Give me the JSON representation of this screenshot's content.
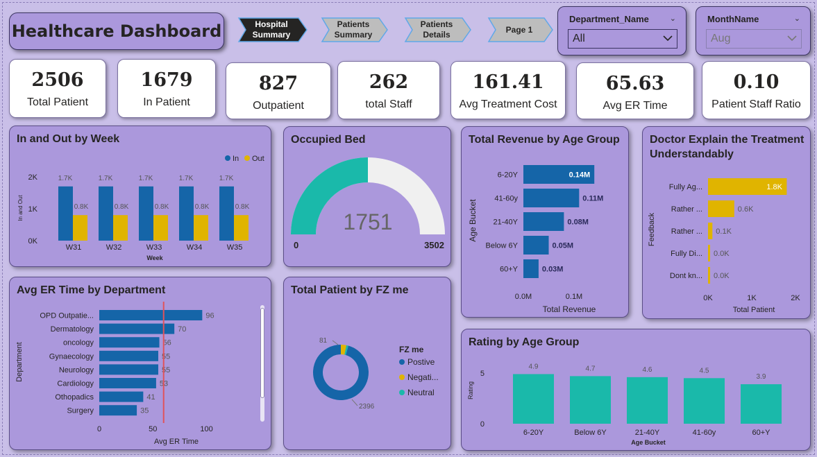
{
  "header": {
    "title": "Healthcare Dashboard"
  },
  "nav": [
    {
      "label": "Hospital\nSummary",
      "active": true
    },
    {
      "label": "Patients\nSummary",
      "active": false
    },
    {
      "label": "Patients\nDetails",
      "active": false
    },
    {
      "label": "Page 1",
      "active": false
    }
  ],
  "slicers": {
    "department": {
      "label": "Department_Name",
      "value": "All"
    },
    "month": {
      "label": "MonthName",
      "value": "Aug"
    }
  },
  "kpis": [
    {
      "value": "2506",
      "label": "Total Patient"
    },
    {
      "value": "1679",
      "label": "In Patient"
    },
    {
      "value": "827",
      "label": "Outpatient"
    },
    {
      "value": "262",
      "label": "total Staff"
    },
    {
      "value": "161.41",
      "label": "Avg Treatment Cost"
    },
    {
      "value": "65.63",
      "label": "Avg ER Time"
    },
    {
      "value": "0.10",
      "label": "Patient Staff Ratio"
    }
  ],
  "colors": {
    "blue": "#1565a8",
    "gold": "#e0b400",
    "teal": "#1ab9aa",
    "gauge_bg": "#f0f0f0",
    "ref_line": "#e0535b"
  },
  "titles": {
    "in_out": "In and Out by Week",
    "occupied": "Occupied Bed",
    "revenue": "Total Revenue by Age Group",
    "doctor": "Doctor Explain the Treatment Understandably",
    "er": "Avg ER Time by Department",
    "fz": "Total Patient by FZ me",
    "rating": "Rating by Age Group"
  },
  "chart_data": [
    {
      "id": "in_out",
      "type": "bar",
      "categories": [
        "W31",
        "W32",
        "W33",
        "W34",
        "W35"
      ],
      "series": [
        {
          "name": "In",
          "values": [
            1700,
            1700,
            1700,
            1700,
            1700
          ],
          "labels": [
            "1.7K",
            "1.7K",
            "1.7K",
            "1.7K",
            "1.7K"
          ]
        },
        {
          "name": "Out",
          "values": [
            800,
            800,
            800,
            800,
            800
          ],
          "labels": [
            "0.8K",
            "0.8K",
            "0.8K",
            "0.8K",
            "0.8K"
          ]
        }
      ],
      "xlabel": "Week",
      "ylabel": "In and Out",
      "yticks": [
        "0K",
        "1K",
        "2K"
      ],
      "ylim": [
        0,
        2000
      ],
      "legend": "top-right"
    },
    {
      "id": "occupied",
      "type": "gauge",
      "value": 1751,
      "value_label": "1751",
      "min": 0,
      "max": 3502,
      "min_label": "0",
      "max_label": "3502"
    },
    {
      "id": "revenue",
      "type": "bar",
      "orientation": "horizontal",
      "categories": [
        "6-20Y",
        "41-60y",
        "21-40Y",
        "Below 6Y",
        "60+Y"
      ],
      "values": [
        0.14,
        0.11,
        0.08,
        0.05,
        0.03
      ],
      "labels": [
        "0.14M",
        "0.11M",
        "0.08M",
        "0.05M",
        "0.03M"
      ],
      "xlabel": "Total Revenue",
      "ylabel": "Age Bucket",
      "xticks": [
        "0.0M",
        "0.1M"
      ],
      "xlim": [
        0,
        0.2
      ]
    },
    {
      "id": "doctor",
      "type": "bar",
      "orientation": "horizontal",
      "categories": [
        "Fully Ag...",
        "Rather ...",
        "Rather ...",
        "Fully Di...",
        "Dont kn..."
      ],
      "values": [
        1800,
        600,
        100,
        0,
        0
      ],
      "labels": [
        "1.8K",
        "0.6K",
        "0.1K",
        "0.0K",
        "0.0K"
      ],
      "xlabel": "Total Patient",
      "ylabel": "Feedback",
      "xticks": [
        "0K",
        "1K",
        "2K"
      ],
      "xlim": [
        0,
        2000
      ]
    },
    {
      "id": "er",
      "type": "bar",
      "orientation": "horizontal",
      "categories": [
        "OPD Outpatie...",
        "Dermatology",
        "oncology",
        "Gynaecology",
        "Neurology",
        "Cardiology",
        "Othopadics",
        "Surgery"
      ],
      "values": [
        96,
        70,
        56,
        55,
        55,
        53,
        41,
        35
      ],
      "labels": [
        "96",
        "70",
        "56",
        "55",
        "55",
        "53",
        "41",
        "35"
      ],
      "xlabel": "Avg ER Time",
      "ylabel": "Department",
      "xticks": [
        "0",
        "50",
        "100"
      ],
      "xlim": [
        0,
        110
      ],
      "reference_line": 60
    },
    {
      "id": "fz",
      "type": "pie",
      "donut": true,
      "legend_title": "FZ me",
      "legend": [
        "Postive",
        "Negati...",
        "Neutral"
      ],
      "values": [
        2396,
        81,
        29
      ],
      "labels": [
        "2396",
        "81",
        ""
      ]
    },
    {
      "id": "rating",
      "type": "bar",
      "categories": [
        "6-20Y",
        "Below 6Y",
        "21-40Y",
        "41-60y",
        "60+Y"
      ],
      "values": [
        4.9,
        4.7,
        4.6,
        4.5,
        3.9
      ],
      "labels": [
        "4.9",
        "4.7",
        "4.6",
        "4.5",
        "3.9"
      ],
      "xlabel": "Age Bucket",
      "ylabel": "Rating",
      "yticks": [
        "0",
        "5"
      ],
      "ylim": [
        0,
        5
      ]
    }
  ]
}
